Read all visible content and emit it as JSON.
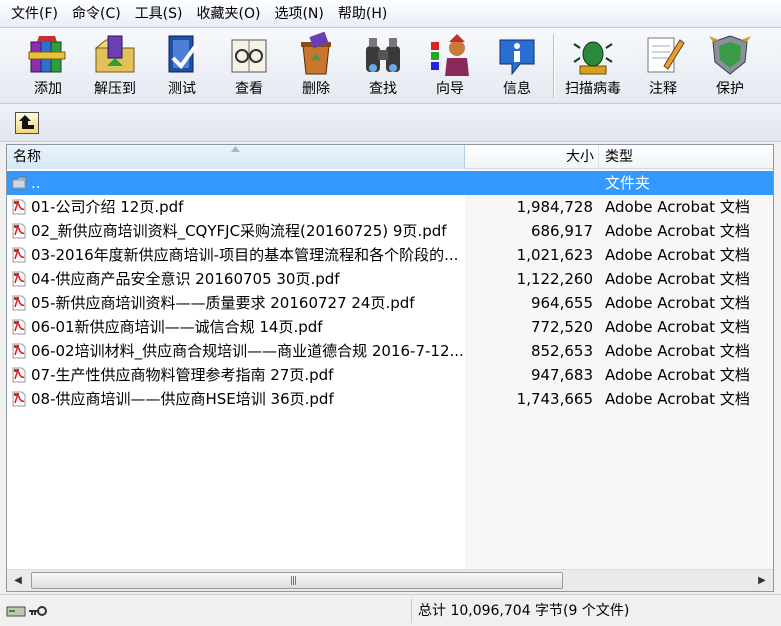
{
  "menu": [
    "文件(F)",
    "命令(C)",
    "工具(S)",
    "收藏夹(O)",
    "选项(N)",
    "帮助(H)"
  ],
  "toolbar": {
    "add": "添加",
    "extract": "解压到",
    "test": "测试",
    "view": "查看",
    "delete": "删除",
    "find": "查找",
    "wizard": "向导",
    "info": "信息",
    "scan": "扫描病毒",
    "comment": "注释",
    "protect": "保护"
  },
  "columns": {
    "name": "名称",
    "size": "大小",
    "type": "类型"
  },
  "files": [
    {
      "name": "..",
      "size": "",
      "type": "文件夹",
      "icon": "folder-icon"
    },
    {
      "name": "01-公司介绍 12页.pdf",
      "size": "1,984,728",
      "type": "Adobe Acrobat 文档",
      "icon": "pdf-icon"
    },
    {
      "name": "02_新供应商培训资料_CQYFJC采购流程(20160725) 9页.pdf",
      "size": "686,917",
      "type": "Adobe Acrobat 文档",
      "icon": "pdf-icon"
    },
    {
      "name": "03-2016年度新供应商培训-项目的基本管理流程和各个阶段的...",
      "size": "1,021,623",
      "type": "Adobe Acrobat 文档",
      "icon": "pdf-icon"
    },
    {
      "name": "04-供应商产品安全意识 20160705 30页.pdf",
      "size": "1,122,260",
      "type": "Adobe Acrobat 文档",
      "icon": "pdf-icon"
    },
    {
      "name": "05-新供应商培训资料——质量要求 20160727 24页.pdf",
      "size": "964,655",
      "type": "Adobe Acrobat 文档",
      "icon": "pdf-icon"
    },
    {
      "name": "06-01新供应商培训——诚信合规 14页.pdf",
      "size": "772,520",
      "type": "Adobe Acrobat 文档",
      "icon": "pdf-icon"
    },
    {
      "name": "06-02培训材料_供应商合规培训——商业道德合规 2016-7-12...",
      "size": "852,653",
      "type": "Adobe Acrobat 文档",
      "icon": "pdf-icon"
    },
    {
      "name": "07-生产性供应商物料管理参考指南 27页.pdf",
      "size": "947,683",
      "type": "Adobe Acrobat 文档",
      "icon": "pdf-icon"
    },
    {
      "name": "08-供应商培训——供应商HSE培训 36页.pdf",
      "size": "1,743,665",
      "type": "Adobe Acrobat 文档",
      "icon": "pdf-icon"
    }
  ],
  "status": {
    "summary": "总计 10,096,704 字节(9 个文件)"
  },
  "colors": {
    "selection": "#3399ff",
    "pdf_red": "#d8262b"
  }
}
